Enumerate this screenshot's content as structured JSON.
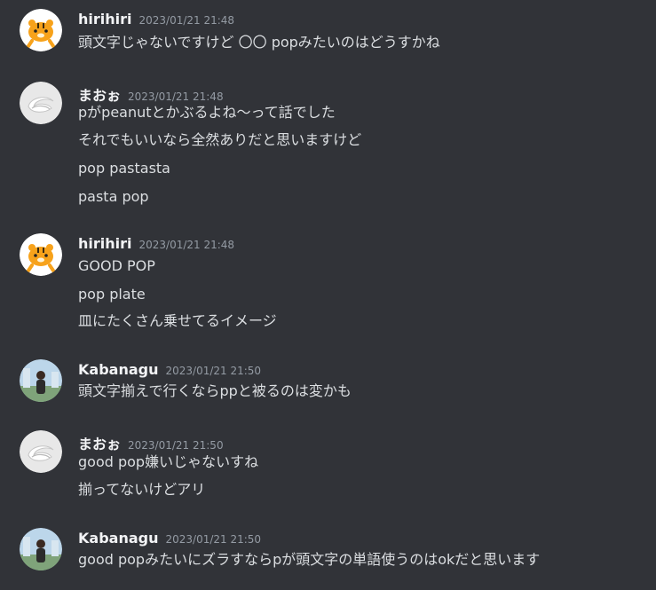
{
  "messages": [
    {
      "author": "hirihiri",
      "avatar": "tiger-avatar-icon",
      "timestamp": "2023/01/21 21:48",
      "lines": [
        "頭文字じゃないですけど 〇〇 popみたいのはどうすかね"
      ]
    },
    {
      "author": "まおぉ",
      "avatar": "white-swirl-avatar-icon",
      "timestamp": "2023/01/21 21:48",
      "lines": [
        "pがpeanutとかぶるよね〜って話でした",
        "それでもいいなら全然ありだと思いますけど",
        "pop pastasta",
        "pasta pop"
      ]
    },
    {
      "author": "hirihiri",
      "avatar": "tiger-avatar-icon",
      "timestamp": "2023/01/21 21:48",
      "lines": [
        "GOOD POP",
        "pop plate",
        "皿にたくさん乗せてるイメージ"
      ]
    },
    {
      "author": "Kabanagu",
      "avatar": "person-photo-avatar-icon",
      "timestamp": "2023/01/21 21:50",
      "lines": [
        "頭文字揃えで行くならppと被るのは変かも"
      ]
    },
    {
      "author": "まおぉ",
      "avatar": "white-swirl-avatar-icon",
      "timestamp": "2023/01/21 21:50",
      "lines": [
        "good pop嫌いじゃないすね",
        "揃ってないけどアリ"
      ]
    },
    {
      "author": "Kabanagu",
      "avatar": "person-photo-avatar-icon",
      "timestamp": "2023/01/21 21:50",
      "lines": [
        "good popみたいにズラすならpが頭文字の単語使うのはokだと思います"
      ]
    }
  ],
  "colors": {
    "background": "#313338",
    "username": "#f2f3f5",
    "text": "#dbdee1",
    "timestamp": "#949ba4"
  }
}
